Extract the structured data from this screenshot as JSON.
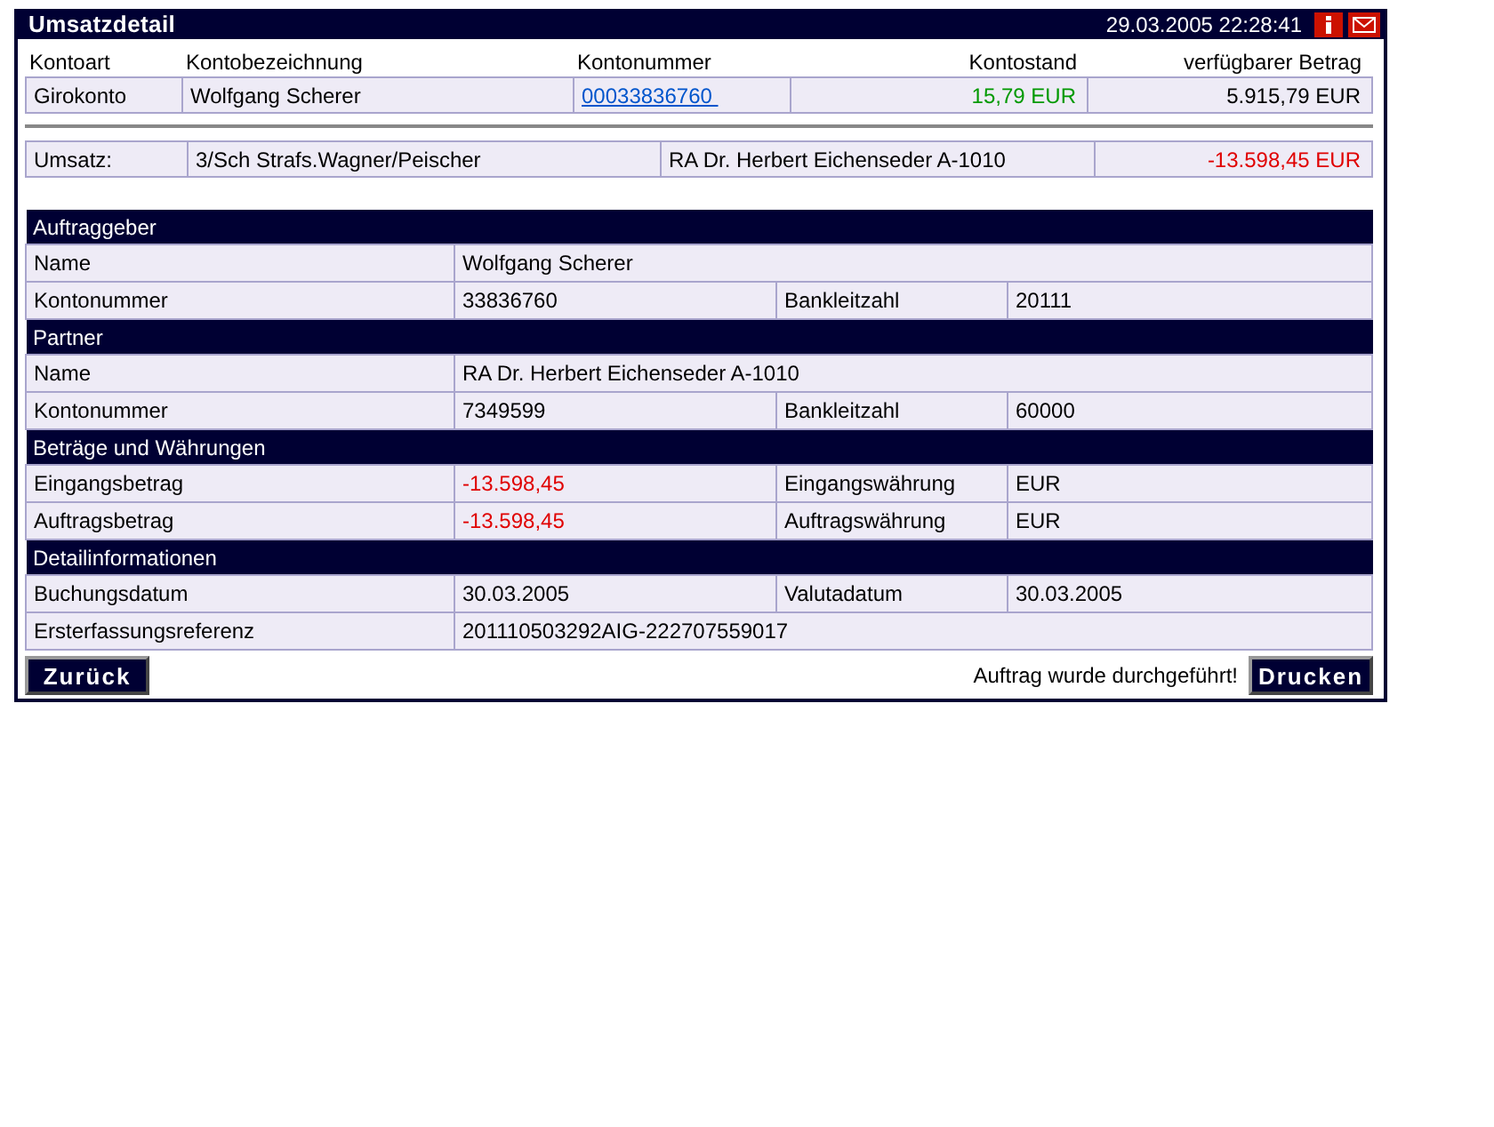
{
  "window": {
    "title": "Umsatzdetail",
    "datetime": "29.03.2005 22:28:41"
  },
  "account": {
    "columns": [
      {
        "label": "Kontoart",
        "kind": "text"
      },
      {
        "label": "Kontobezeichnung",
        "kind": "text"
      },
      {
        "label": "Kontonummer",
        "kind": "link"
      },
      {
        "label": "Kontostand",
        "kind": "amount"
      },
      {
        "label": "verfügbarer Betrag",
        "kind": "amount"
      }
    ],
    "cells": [
      {
        "text": "Girokonto",
        "kind": "text"
      },
      {
        "text": "Wolfgang Scherer",
        "kind": "text"
      },
      {
        "text": "00033836760 ",
        "kind": "link"
      },
      {
        "text": "15,79 EUR",
        "kind": "amount",
        "color": "#009900"
      },
      {
        "text": "5.915,79 EUR",
        "kind": "amount",
        "color": "#000000"
      }
    ]
  },
  "transaction": {
    "cells": [
      {
        "text": "Umsatz:",
        "kind": "text"
      },
      {
        "text": "3/Sch Strafs.Wagner/Peischer",
        "kind": "text"
      },
      {
        "text": "RA Dr. Herbert Eichenseder A-1010",
        "kind": "text"
      },
      {
        "text": "-13.598,45 EUR",
        "kind": "amount",
        "color": "#e00000"
      }
    ]
  },
  "sections": [
    {
      "title": "Auftraggeber",
      "rows": [
        {
          "label": "Name",
          "value": "Wolfgang Scherer"
        },
        {
          "label": "Kontonummer",
          "value": "33836760",
          "label2": "Bankleitzahl",
          "value2": "20111"
        }
      ]
    },
    {
      "title": "Partner",
      "rows": [
        {
          "label": "Name",
          "value": "RA Dr. Herbert Eichenseder A-1010"
        },
        {
          "label": "Kontonummer",
          "value": "7349599",
          "label2": "Bankleitzahl",
          "value2": "60000"
        }
      ]
    },
    {
      "title": "Beträge und Währungen",
      "rows": [
        {
          "label": "Eingangsbetrag",
          "value": "-13.598,45",
          "color": "#e00000",
          "label2": "Eingangswährung",
          "value2": "EUR"
        },
        {
          "label": "Auftragsbetrag",
          "value": "-13.598,45",
          "color": "#e00000",
          "label2": "Auftragswährung",
          "value2": "EUR"
        }
      ]
    },
    {
      "title": "Detailinformationen",
      "rows": [
        {
          "label": "Buchungsdatum",
          "value": "30.03.2005",
          "label2": "Valutadatum",
          "value2": "30.03.2005"
        },
        {
          "label": "Ersterfassungsreferenz",
          "value": "201110503292AIG-222707559017"
        }
      ]
    }
  ],
  "footer": {
    "back_button": "Zurück",
    "status": "Auftrag wurde durchgeführt!",
    "print_button": "Drucken"
  }
}
